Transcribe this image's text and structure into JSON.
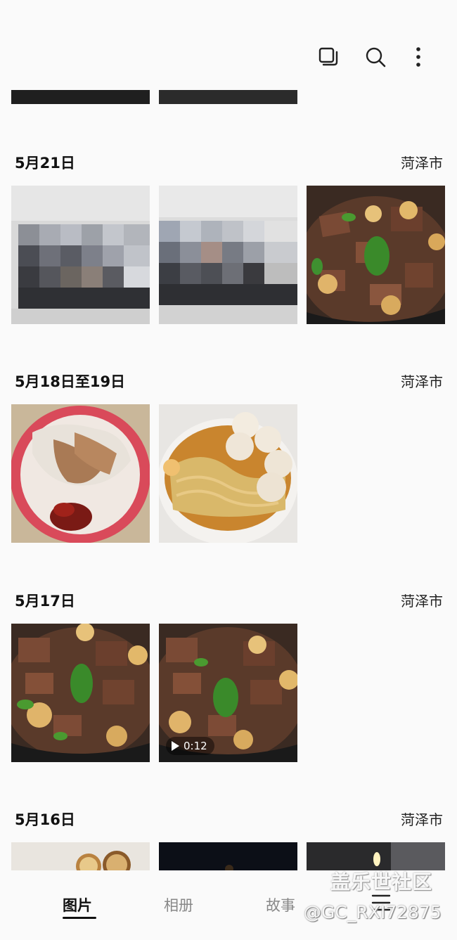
{
  "toolbar": {
    "select_icon": "select-multiple-icon",
    "search_icon": "search-icon",
    "more_icon": "more-vertical-icon"
  },
  "sections": [
    {
      "date": "5月21日",
      "location": "菏泽市"
    },
    {
      "date": "5月18日至19日",
      "location": "菏泽市"
    },
    {
      "date": "5月17日",
      "location": "菏泽市"
    },
    {
      "date": "5月16日",
      "location": "菏泽市"
    }
  ],
  "video": {
    "duration": "0:12"
  },
  "nav": {
    "tabs": [
      {
        "label": "图片",
        "active": true
      },
      {
        "label": "相册",
        "active": false
      },
      {
        "label": "故事",
        "active": false
      }
    ],
    "menu_icon": "menu-icon"
  },
  "watermark": {
    "line1": "盖乐世社区",
    "line2": "@GC_RXI72875"
  },
  "colors": {
    "background": "#fafafa",
    "text": "#111111"
  }
}
